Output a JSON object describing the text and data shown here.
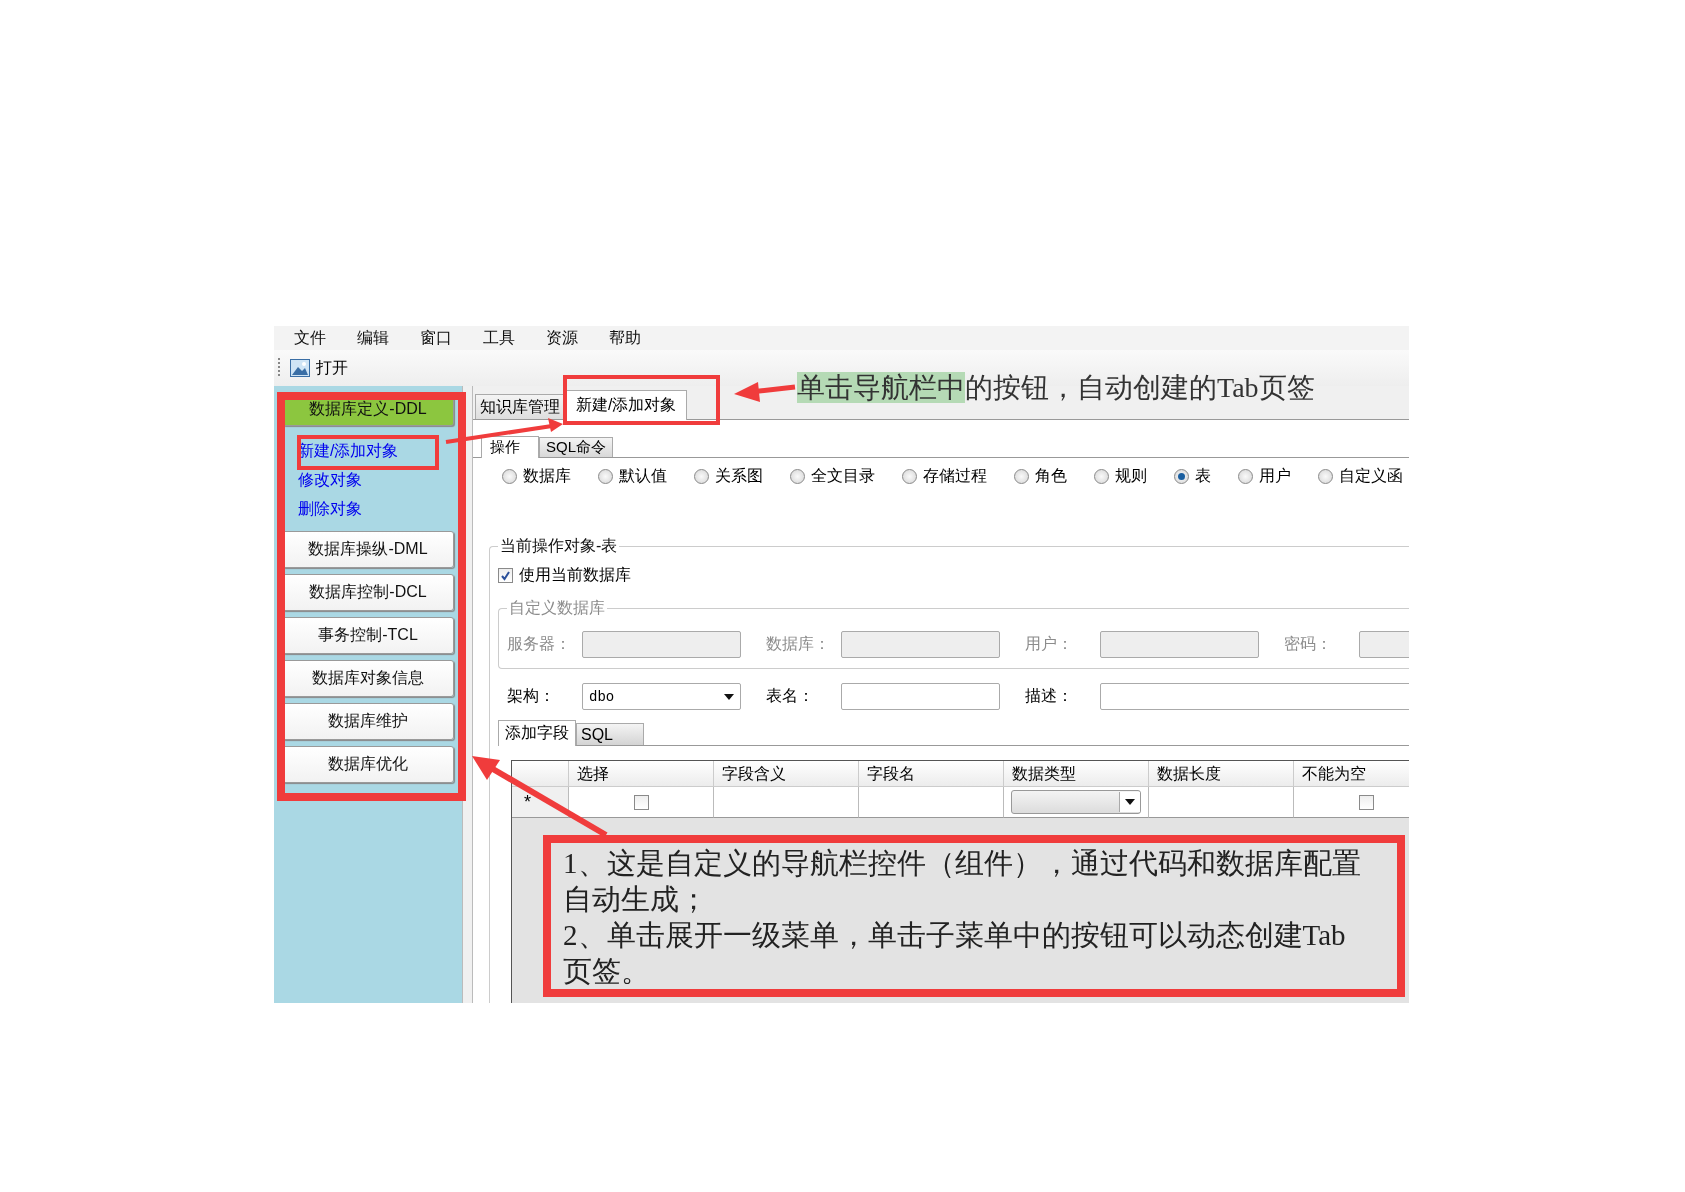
{
  "menu": [
    "文件",
    "编辑",
    "窗口",
    "工具",
    "资源",
    "帮助"
  ],
  "toolbar": [
    {
      "label": "打开"
    }
  ],
  "nav": {
    "groups": [
      {
        "label": "数据库定义-DDL",
        "expanded": true,
        "items": [
          "新建/添加对象",
          "修改对象",
          "删除对象"
        ]
      },
      {
        "label": "数据库操纵-DML",
        "expanded": false
      },
      {
        "label": "数据库控制-DCL",
        "expanded": false
      },
      {
        "label": "事务控制-TCL",
        "expanded": false
      },
      {
        "label": "数据库对象信息",
        "expanded": false
      },
      {
        "label": "数据库维护",
        "expanded": false
      },
      {
        "label": "数据库优化",
        "expanded": false
      }
    ]
  },
  "tabs": [
    {
      "label": "知识库管理",
      "selected": false
    },
    {
      "label": "新建/添加对象",
      "selected": true
    }
  ],
  "subtabs": [
    {
      "label": "操作",
      "selected": true
    },
    {
      "label": "SQL命令",
      "selected": false
    }
  ],
  "object_types": [
    {
      "label": "数据库",
      "selected": false
    },
    {
      "label": "默认值",
      "selected": false
    },
    {
      "label": "关系图",
      "selected": false
    },
    {
      "label": "全文目录",
      "selected": false
    },
    {
      "label": "存储过程",
      "selected": false
    },
    {
      "label": "角色",
      "selected": false
    },
    {
      "label": "规则",
      "selected": false
    },
    {
      "label": "表",
      "selected": true
    },
    {
      "label": "用户",
      "selected": false
    },
    {
      "label": "自定义函",
      "selected": false
    }
  ],
  "object_group": {
    "title": "当前操作对象-表",
    "use_current_db": {
      "label": "使用当前数据库",
      "checked": true
    },
    "custom_db": {
      "title": "自定义数据库",
      "disabled": true,
      "fields": [
        {
          "label": "服务器："
        },
        {
          "label": "数据库："
        },
        {
          "label": "用户："
        },
        {
          "label": "密码："
        }
      ]
    },
    "schema": {
      "label": "架构：",
      "value": "dbo"
    },
    "table_name": {
      "label": "表名："
    },
    "description": {
      "label": "描述："
    }
  },
  "field_tabs": [
    {
      "label": "添加字段",
      "selected": true
    },
    {
      "label": "SQL",
      "selected": false
    }
  ],
  "grid": {
    "columns": [
      "选择",
      "字段含义",
      "字段名",
      "数据类型",
      "数据长度",
      "不能为空"
    ],
    "new_row": {
      "marker": "*",
      "select_checked": false,
      "not_null_checked": false
    }
  },
  "annotations": {
    "tab_note": {
      "parts": [
        {
          "text": "单击导航栏中",
          "highlighted": true
        },
        {
          "text": "的按钮，自动创建的Tab页签",
          "highlighted": false
        }
      ]
    },
    "nav_note": {
      "paragraphs": [
        "1、这是自定义的导航栏控件（组件），通过代码和数据库配置自动生成；",
        "2、单击展开一级菜单，单击子菜单中的按钮可以动态创建Tab页签。"
      ]
    }
  }
}
